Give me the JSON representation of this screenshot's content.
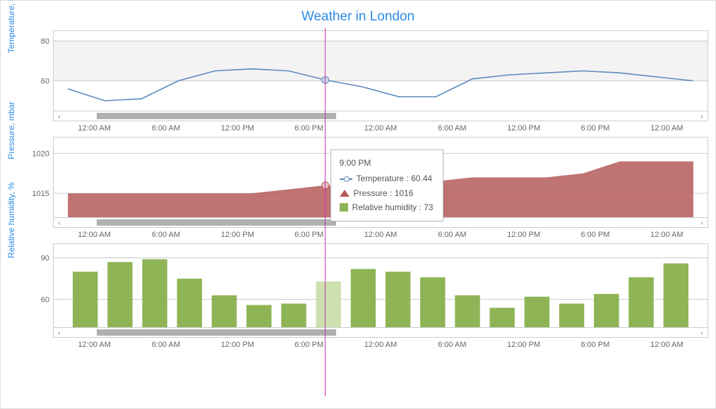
{
  "title": "Weather in London",
  "x_labels": [
    "12:00 AM",
    "6:00 AM",
    "12:00 PM",
    "6:00 PM",
    "12:00 AM",
    "6:00 AM",
    "12:00 PM",
    "6:00 PM",
    "12:00 AM"
  ],
  "scroll": {
    "start_pct": 5,
    "width_pct": 38
  },
  "crosshair": {
    "x_label": "9:00 PM",
    "pos_pct": 47.2
  },
  "tooltip": {
    "time": "9:00 PM",
    "rows": [
      {
        "kind": "line",
        "label": "Temperature",
        "value": "60.44"
      },
      {
        "kind": "area",
        "label": "Pressure",
        "value": "1016"
      },
      {
        "kind": "bar",
        "label": "Relative humidity",
        "value": "73"
      }
    ]
  },
  "charts": {
    "temperature": {
      "ylabel": "Temperature, F",
      "yticks": [
        "80",
        "60"
      ],
      "height": 115
    },
    "pressure": {
      "ylabel": "Pressure, mbar",
      "yticks": [
        "1020",
        "1015"
      ],
      "height": 115
    },
    "humidity": {
      "ylabel": "Relative humidity, %",
      "yticks": [
        "90",
        "60"
      ],
      "height": 120
    }
  },
  "chart_data": [
    {
      "type": "line",
      "name": "Temperature",
      "title": "Weather in London",
      "xlabel": "",
      "ylabel": "Temperature, F",
      "ylim": [
        45,
        85
      ],
      "x": [
        "12:00 AM",
        "3:00 AM",
        "6:00 AM",
        "9:00 AM",
        "12:00 PM",
        "3:00 PM",
        "6:00 PM",
        "9:00 PM",
        "12:00 AM",
        "3:00 AM",
        "6:00 AM",
        "9:00 AM",
        "12:00 PM",
        "3:00 PM",
        "6:00 PM",
        "9:00 PM",
        "12:00 AM",
        "3:00 AM"
      ],
      "values": [
        56,
        50,
        51,
        60,
        65,
        66,
        65,
        60.44,
        57,
        52,
        52,
        61,
        63,
        64,
        65,
        64,
        62,
        60
      ],
      "crosshair_index": 7
    },
    {
      "type": "area",
      "name": "Pressure",
      "xlabel": "",
      "ylabel": "Pressure, mbar",
      "ylim": [
        1012,
        1022
      ],
      "x": [
        "12:00 AM",
        "3:00 AM",
        "6:00 AM",
        "9:00 AM",
        "12:00 PM",
        "3:00 PM",
        "6:00 PM",
        "9:00 PM",
        "12:00 AM",
        "3:00 AM",
        "6:00 AM",
        "9:00 AM",
        "12:00 PM",
        "3:00 PM",
        "6:00 PM",
        "9:00 PM",
        "12:00 AM",
        "3:00 AM"
      ],
      "values": [
        1015,
        1015,
        1015,
        1015,
        1015,
        1015,
        1015.5,
        1016,
        1016,
        1016,
        1016.5,
        1017,
        1017,
        1017,
        1017.5,
        1019,
        1019,
        1019
      ],
      "crosshair_index": 7
    },
    {
      "type": "bar",
      "name": "Relative humidity",
      "xlabel": "",
      "ylabel": "Relative humidity, %",
      "ylim": [
        40,
        100
      ],
      "categories": [
        "12:00 AM",
        "3:00 AM",
        "6:00 AM",
        "9:00 AM",
        "12:00 PM",
        "3:00 PM",
        "6:00 PM",
        "9:00 PM",
        "12:00 AM",
        "3:00 AM",
        "6:00 AM",
        "9:00 AM",
        "12:00 PM",
        "3:00 PM",
        "6:00 PM",
        "9:00 PM",
        "12:00 AM",
        "3:00 AM"
      ],
      "values": [
        80,
        87,
        89,
        75,
        63,
        56,
        57,
        73,
        82,
        80,
        76,
        63,
        54,
        62,
        57,
        64,
        76,
        86
      ],
      "crosshair_index": 7
    }
  ]
}
